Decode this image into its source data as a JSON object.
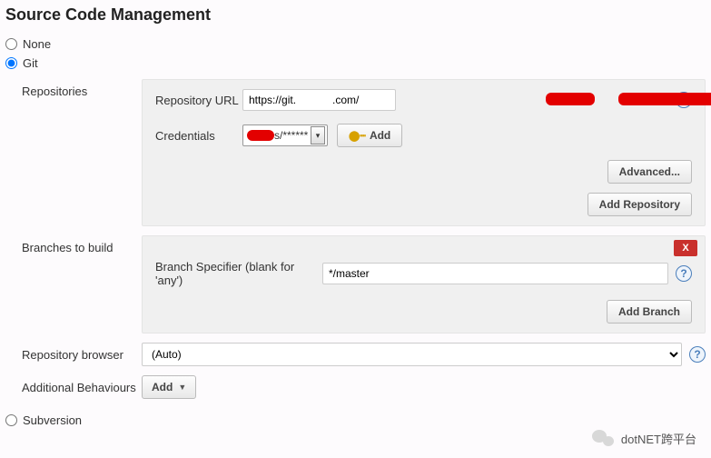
{
  "title": "Source Code Management",
  "scm": {
    "none": "None",
    "git": "Git",
    "subversion": "Subversion"
  },
  "repositories": {
    "label": "Repositories",
    "repoUrlLabel": "Repository URL",
    "repoUrlValue": "https://git.            .com/",
    "credentialsLabel": "Credentials",
    "credentialsSuffix": "s/******",
    "addBtn": "Add",
    "advancedBtn": "Advanced...",
    "addRepoBtn": "Add Repository"
  },
  "branches": {
    "label": "Branches to build",
    "specifierLabel": "Branch Specifier (blank for 'any')",
    "specifierValue": "*/master",
    "closeX": "X",
    "addBranchBtn": "Add Branch"
  },
  "browser": {
    "label": "Repository browser",
    "value": "(Auto)"
  },
  "behaviours": {
    "label": "Additional Behaviours",
    "addBtn": "Add"
  },
  "footer": {
    "tag": "dotNET跨平台"
  }
}
